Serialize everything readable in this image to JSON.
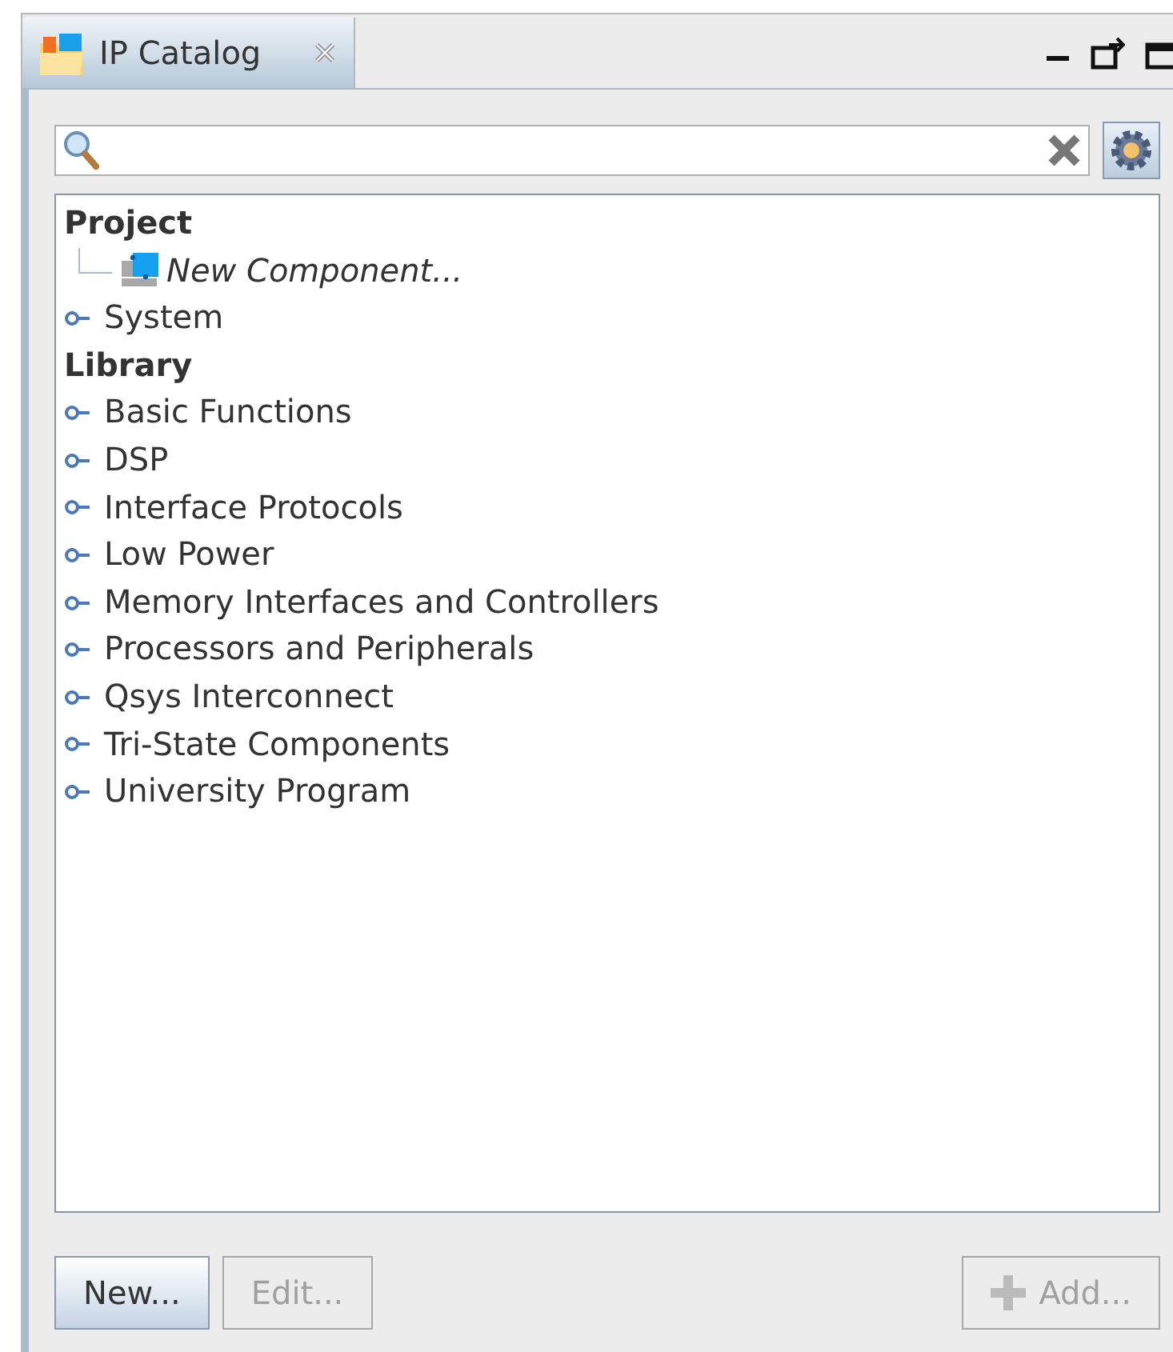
{
  "tab": {
    "title": "IP Catalog",
    "selected": true
  },
  "tree": [
    {
      "label": "Project",
      "kind": "heading",
      "children": [
        {
          "label": "New Component...",
          "kind": "leaf"
        },
        {
          "label": "System",
          "kind": "node",
          "expanded": false
        }
      ]
    },
    {
      "label": "Library",
      "kind": "heading",
      "children": [
        {
          "label": "Basic Functions",
          "kind": "node",
          "expanded": false
        },
        {
          "label": "DSP",
          "kind": "node",
          "expanded": false
        },
        {
          "label": "Interface Protocols",
          "kind": "node",
          "expanded": false
        },
        {
          "label": "Low Power",
          "kind": "node",
          "expanded": false
        },
        {
          "label": "Memory Interfaces and Controllers",
          "kind": "node",
          "expanded": false
        },
        {
          "label": "Processors and Peripherals",
          "kind": "node",
          "expanded": false
        },
        {
          "label": "Qsys Interconnect",
          "kind": "node",
          "expanded": false
        },
        {
          "label": "Tri-State Components",
          "kind": "node",
          "expanded": false
        },
        {
          "label": "University Program",
          "kind": "node",
          "expanded": false
        }
      ]
    }
  ],
  "buttons": [
    {
      "label": "New...",
      "disabled": false,
      "kind": "plain"
    },
    {
      "label": "Edit...",
      "disabled": true,
      "kind": "plain"
    },
    {
      "label": "Add...",
      "disabled": true,
      "kind": "add"
    }
  ]
}
